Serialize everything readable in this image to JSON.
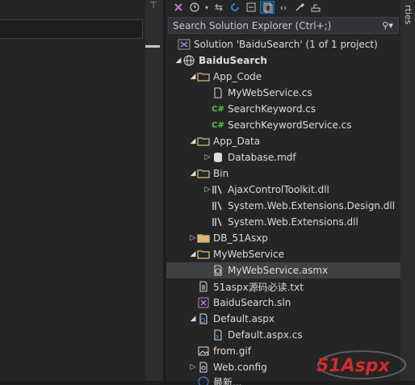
{
  "window": {
    "right_tab_label": "rties"
  },
  "search": {
    "placeholder": "Search Solution Explorer (Ctrl+;)"
  },
  "tree": {
    "solution_label": "Solution 'BaiduSearch' (1 of 1 project)",
    "project_label": "BaiduSearch",
    "app_code": {
      "label": "App_Code",
      "items": [
        "MyWebService.cs",
        "SearchKeyword.cs",
        "SearchKeywordService.cs"
      ]
    },
    "app_data": {
      "label": "App_Data",
      "items": [
        "Database.mdf"
      ]
    },
    "bin": {
      "label": "Bin",
      "items": [
        "AjaxControlToolkit.dll",
        "System.Web.Extensions.Design.dll",
        "System.Web.Extensions.dll"
      ]
    },
    "db_folder": "DB_51Asxp",
    "mywebservice_folder": {
      "label": "MyWebService",
      "items": [
        "MyWebService.asmx"
      ]
    },
    "readme": "51aspx源码必读.txt",
    "sln_file": "BaiduSearch.sln",
    "default": {
      "label": "Default.aspx",
      "items": [
        "Default.aspx.cs"
      ]
    },
    "from_gif": "from.gif",
    "web_config": "Web.config",
    "truncated_item": "最新..."
  },
  "watermark": {
    "text": "51Aspx"
  },
  "colors": {
    "accent": "#007acc",
    "folder": "#dcb67a",
    "csharp": "#4ec94e",
    "background": "#252526",
    "selected": "#3f3f46"
  }
}
